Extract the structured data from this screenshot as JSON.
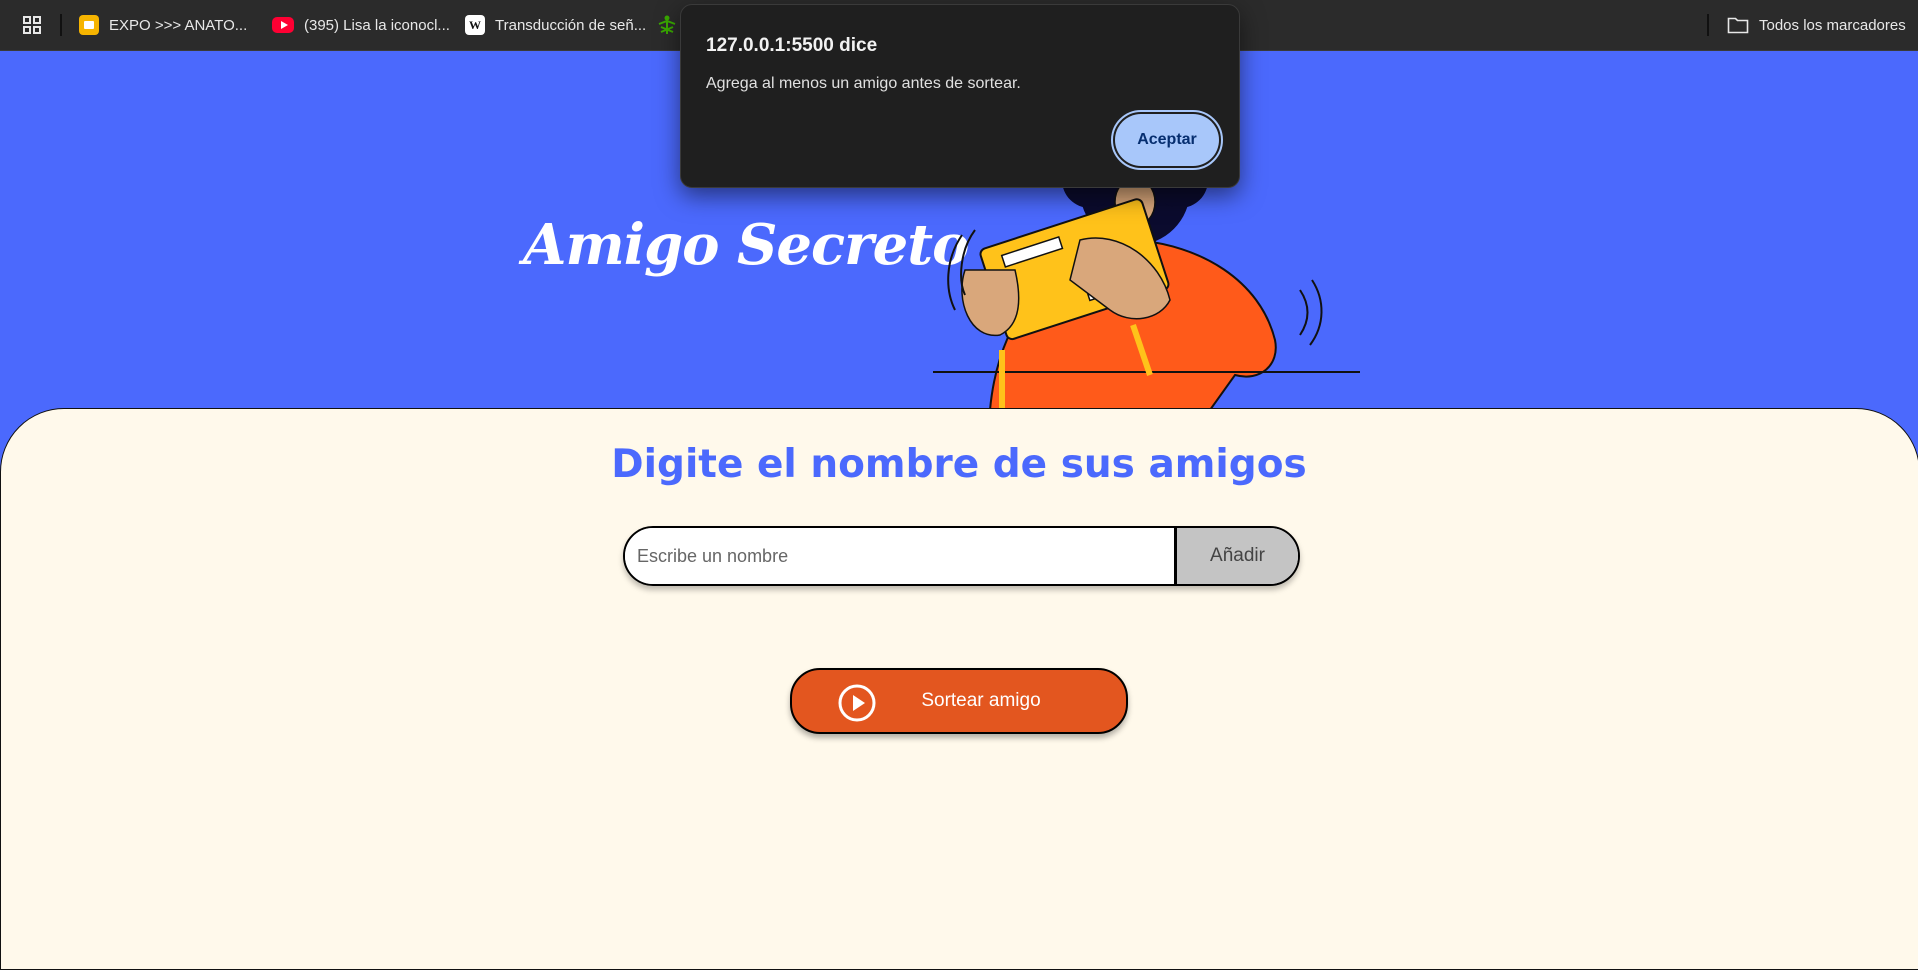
{
  "bookmarks_bar": {
    "items": [
      {
        "label": "EXPO >>> ANATO...",
        "icon": "slides-icon"
      },
      {
        "label": "(395) Lisa la iconocl...",
        "icon": "youtube-icon"
      },
      {
        "label": "Transducción de señ...",
        "icon": "wikipedia-icon"
      },
      {
        "label": "",
        "icon": "sena-logo-icon"
      }
    ],
    "all_bookmarks_label": "Todos los marcadores"
  },
  "header": {
    "title": "Amigo Secreto"
  },
  "main": {
    "section_title": "Digite el nombre de sus amigos",
    "name_input": {
      "value": "",
      "placeholder": "Escribe un nombre"
    },
    "add_button_label": "Añadir",
    "draw_button_label": "Sortear amigo"
  },
  "dialog": {
    "title": "127.0.0.1:5500 dice",
    "message": "Agrega al menos un amigo antes de sortear.",
    "ok_label": "Aceptar"
  },
  "colors": {
    "hero_background": "#4b69fd",
    "card_background": "#fff9eb",
    "accent_blue": "#4b69fd",
    "draw_button": "#e3561f",
    "dialog_button": "#a8c7fa"
  }
}
